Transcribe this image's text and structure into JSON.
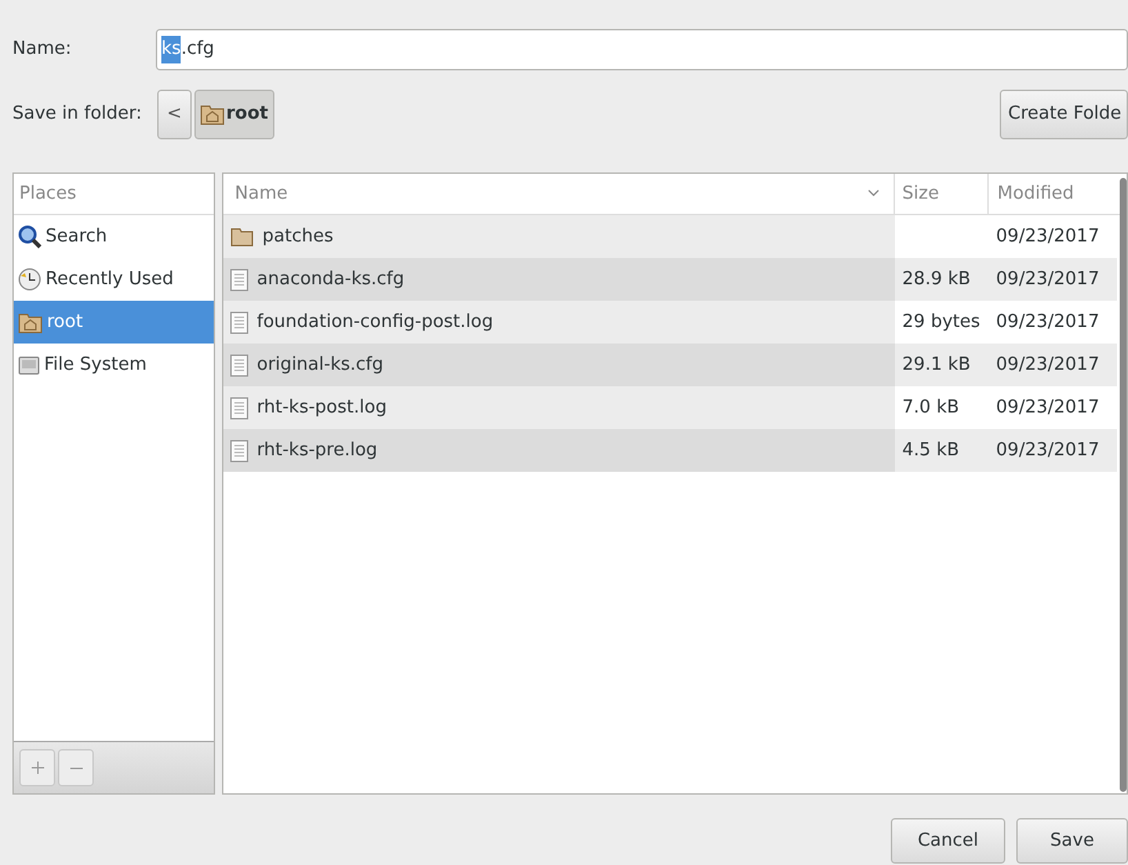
{
  "name_field": {
    "label": "Name:",
    "selected_text": "ks",
    "rest_text": ".cfg"
  },
  "folder_bar": {
    "label": "Save in folder:",
    "back": "<",
    "crumbs": [
      {
        "label": "root",
        "selected": true
      }
    ],
    "create_folder": "Create Folde"
  },
  "places": {
    "header": "Places",
    "items": [
      {
        "label": "Search",
        "kind": "search",
        "selected": false
      },
      {
        "label": "Recently Used",
        "kind": "recent",
        "selected": false
      },
      {
        "label": "root",
        "kind": "home",
        "selected": true
      },
      {
        "label": "File System",
        "kind": "drive",
        "selected": false
      }
    ]
  },
  "files": {
    "columns": [
      "Name",
      "Size",
      "Modified"
    ],
    "rows": [
      {
        "kind": "folder",
        "name": "patches",
        "modified": "09/23/2017"
      },
      {
        "kind": "file",
        "name": "anaconda-ks.cfg",
        "size": "28.9 kB",
        "modified": "09/23/2017"
      },
      {
        "kind": "file",
        "name": "foundation-config-post.log",
        "size": "29 bytes",
        "modified": "09/23/2017"
      },
      {
        "kind": "file",
        "name": "original-ks.cfg",
        "size": "29.1 kB",
        "modified": "09/23/2017"
      },
      {
        "kind": "file",
        "name": "rht-ks-post.log",
        "size": "7.0 kB",
        "modified": "09/23/2017"
      },
      {
        "kind": "file",
        "name": "rht-ks-pre.log",
        "size": "4.5 kB",
        "modified": "09/23/2017"
      }
    ]
  },
  "buttons": [
    "Cancel",
    "Save"
  ]
}
